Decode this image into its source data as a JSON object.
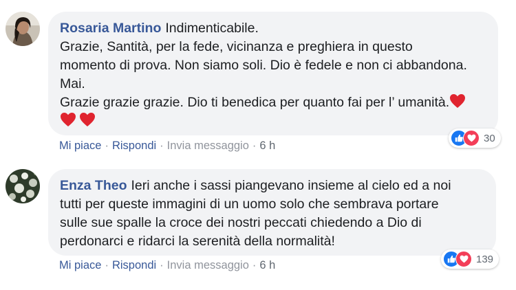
{
  "comments": [
    {
      "author": "Rosaria Martino",
      "lines": [
        "Indimenticabile.",
        "Grazie, Santità, per la fede, vicinanza e preghiera in questo",
        "momento di prova. Non siamo soli. Dio è fedele e non ci abbandona.",
        "Mai.",
        "Grazie grazie grazie. Dio ti benedica per quanto fai per l’ umanità."
      ],
      "like_label": "Mi piace",
      "reply_label": "Rispondi",
      "message_label": "Invia messaggio",
      "time": "6 h",
      "reaction_count": "30",
      "reaction_icons": [
        "like-icon",
        "love-icon"
      ],
      "heart_emojis": 3
    },
    {
      "author": "Enza Theo",
      "lines": [
        "Ieri anche i sassi piangevano insieme al cielo ed a noi",
        "tutti per queste immagini di un uomo solo che sembrava portare",
        "sulle sue spalle la croce dei nostri peccati chiedendo a Dio di",
        "perdonarci e ridarci la serenità della normalità!"
      ],
      "like_label": "Mi piace",
      "reply_label": "Rispondi",
      "message_label": "Invia messaggio",
      "time": "6 h",
      "reaction_count": "139",
      "reaction_icons": [
        "like-icon",
        "love-icon"
      ]
    }
  ],
  "colors": {
    "author": "#385898",
    "bubble": "#f2f3f5",
    "meta": "#90949c",
    "like": "#1877f2",
    "love": "#f33e58",
    "heart": "#e0242f"
  }
}
